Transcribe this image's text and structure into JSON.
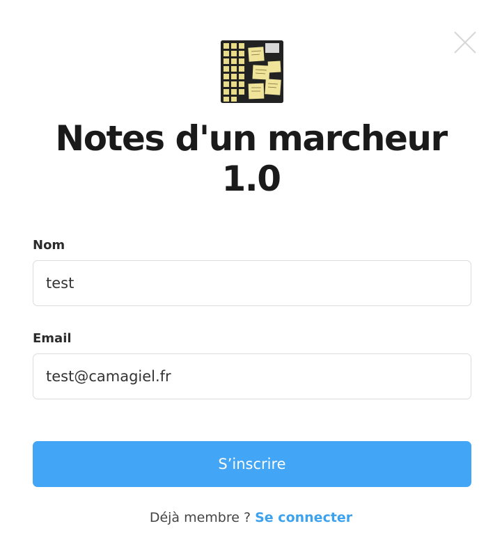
{
  "modal": {
    "title_line1": "Notes d'un marcheur",
    "title_line2": "1.0",
    "logo_icon": "sticky-notes-board-icon",
    "close_icon": "close-icon"
  },
  "form": {
    "name_label": "Nom",
    "name_value": "test",
    "email_label": "Email",
    "email_value": "test@camagiel.fr",
    "submit_label": "S’inscrire"
  },
  "footer": {
    "prompt": "Déjà membre ?",
    "login_link": "Se connecter"
  },
  "colors": {
    "accent": "#42a5f5",
    "link": "#3da2ee",
    "border": "#dcdcdc",
    "text": "#1a1a1a"
  }
}
